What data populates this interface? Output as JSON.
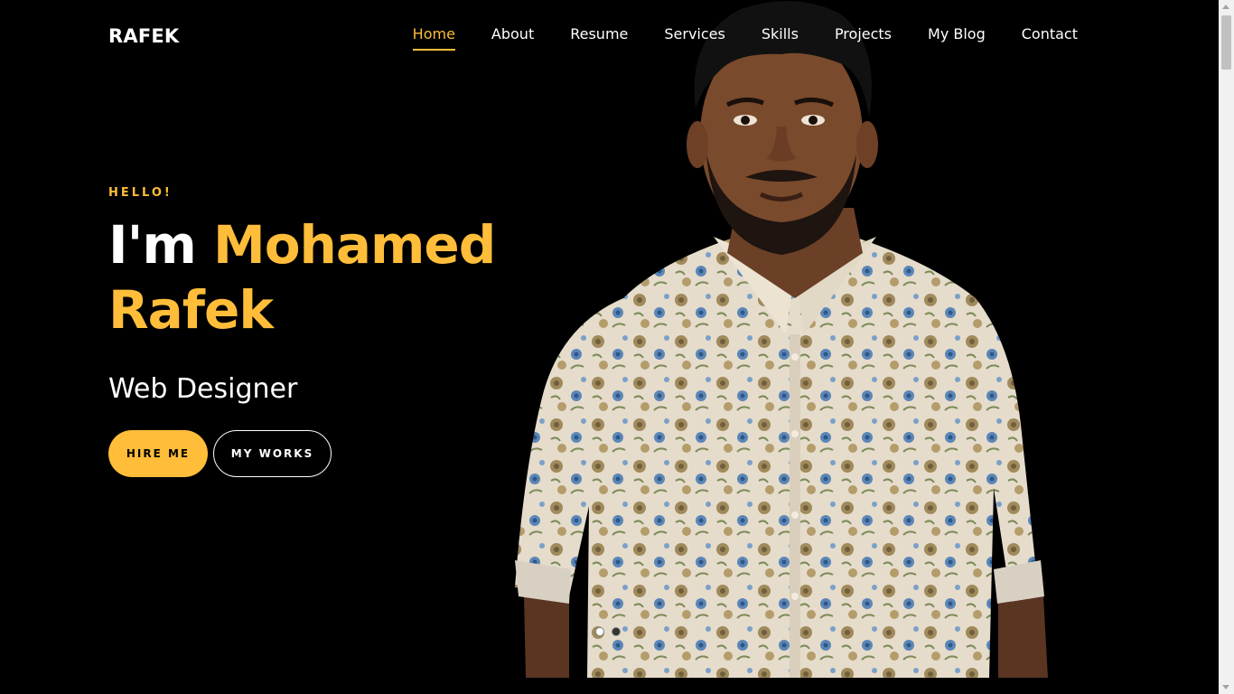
{
  "header": {
    "logo": "RAFEK",
    "nav": [
      {
        "label": "Home",
        "active": true
      },
      {
        "label": "About"
      },
      {
        "label": "Resume"
      },
      {
        "label": "Services"
      },
      {
        "label": "Skills"
      },
      {
        "label": "Projects"
      },
      {
        "label": "My Blog"
      },
      {
        "label": "Contact"
      }
    ]
  },
  "hero": {
    "greeting": "HELLO!",
    "headline_prefix": "I'm",
    "headline_first": "Mohamed",
    "headline_last": "Rafek",
    "role": "Web Designer",
    "primary_button": "HIRE ME",
    "secondary_button": "MY WORKS",
    "slides": 2,
    "active_slide": 1
  },
  "colors": {
    "accent": "#ffbd39",
    "background": "#000000",
    "text": "#ffffff"
  }
}
